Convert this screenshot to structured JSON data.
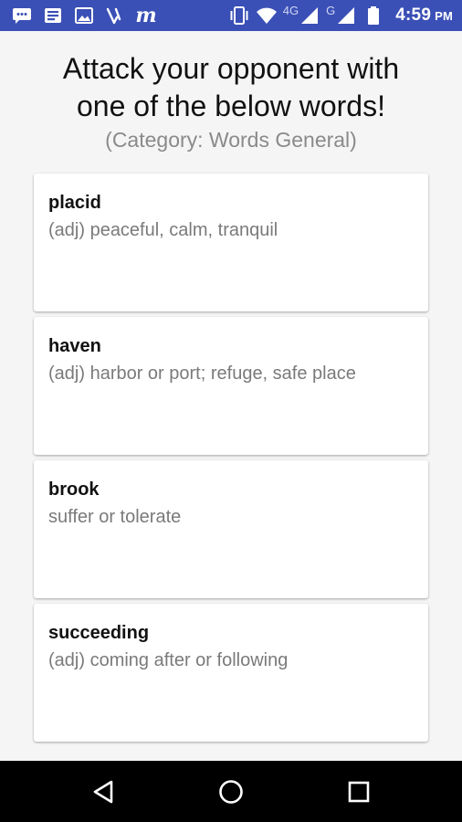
{
  "status_bar": {
    "time": "4:59",
    "ampm": "PM",
    "network_4g": "4G",
    "network_g": "G",
    "icons": [
      "messages-icon",
      "news-icon",
      "image-icon",
      "vine-icon",
      "m-app-icon",
      "vibrate-icon",
      "wifi-icon",
      "signal-4g-icon",
      "signal-g-icon",
      "battery-icon"
    ],
    "accent_color": "#3b50b6"
  },
  "header": {
    "line1": "Attack your opponent with",
    "line2": "one of the below words!",
    "category": "(Category: Words General)"
  },
  "words": [
    {
      "word": "placid",
      "definition": "(adj) peaceful, calm, tranquil"
    },
    {
      "word": "haven",
      "definition": "(adj) harbor or port; refuge, safe place"
    },
    {
      "word": "brook",
      "definition": "suffer or tolerate"
    },
    {
      "word": "succeeding",
      "definition": "(adj) coming after or following"
    }
  ],
  "nav_bar": {
    "icons": [
      "back-icon",
      "home-icon",
      "recents-icon"
    ]
  }
}
